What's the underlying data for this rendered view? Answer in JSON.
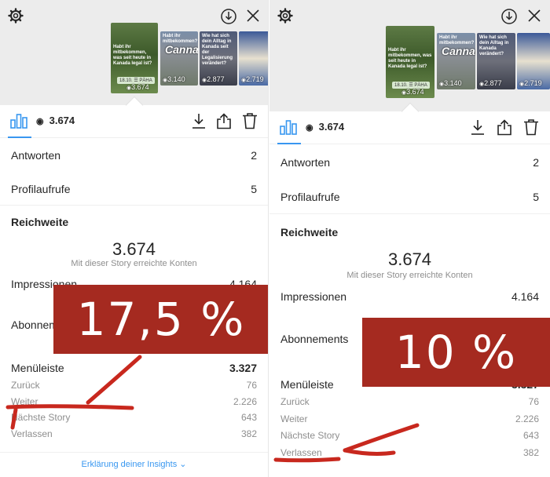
{
  "left": {
    "thumbnails": [
      {
        "caption": "Habt ihr mitbekommen, was seit heute in Kanada legal ist?",
        "pill": "18.10. ☰ PÄHA",
        "views": "3.674",
        "style": "thumb-green"
      },
      {
        "caption": "Habt ihr mitbekommen?",
        "word": "Cannabis",
        "views": "3.140",
        "style": "thumb-city"
      },
      {
        "caption": "Wie hat sich dein Alltag in Kanada seit der Legalisierung verändert?",
        "views": "2.877",
        "style": "thumb-people"
      },
      {
        "caption": "",
        "views": "2.719",
        "style": "thumb-blue"
      }
    ],
    "view_count": "3.674",
    "replies_label": "Antworten",
    "replies_value": "2",
    "profile_visits_label": "Profilaufrufe",
    "profile_visits_value": "5",
    "reach_title": "Reichweite",
    "reach_value": "3.674",
    "reach_caption": "Mit dieser Story erreichte Konten",
    "impressions_label": "Impressionen",
    "impressions_value": "4.164",
    "follows_label": "Abonnements",
    "nav_label": "Menüleiste",
    "nav_value": "3.327",
    "back_label": "Zurück",
    "back_value": "76",
    "forward_label": "Weiter",
    "forward_value": "2.226",
    "next_label": "Nächste Story",
    "next_value": "643",
    "exit_label": "Verlassen",
    "exit_value": "382",
    "footer_link": "Erklärung deiner Insights",
    "overlay_text": "17,5 %"
  },
  "right": {
    "thumbnails": [
      {
        "caption": "Habt ihr mitbekommen, was seit heute in Kanada legal ist?",
        "pill": "18.10. ☰ PÄHA",
        "views": "3.674",
        "style": "thumb-green"
      },
      {
        "caption": "Habt ihr mitbekommen?",
        "word": "Cannabis",
        "views": "3.140",
        "style": "thumb-city"
      },
      {
        "caption": "Wie hat sich dein Alltag in Kanada verändert?",
        "views": "2.877",
        "style": "thumb-people"
      },
      {
        "caption": "",
        "views": "2.719",
        "style": "thumb-blue"
      }
    ],
    "view_count": "3.674",
    "replies_label": "Antworten",
    "replies_value": "2",
    "profile_visits_label": "Profilaufrufe",
    "profile_visits_value": "5",
    "reach_title": "Reichweite",
    "reach_value": "3.674",
    "reach_caption": "Mit dieser Story erreichte Konten",
    "impressions_label": "Impressionen",
    "impressions_value": "4.164",
    "follows_label": "Abonnements",
    "nav_label": "Menüleiste",
    "nav_value": "3.327",
    "back_label": "Zurück",
    "back_value": "76",
    "forward_label": "Weiter",
    "forward_value": "2.226",
    "next_label": "Nächste Story",
    "next_value": "643",
    "exit_label": "Verlassen",
    "exit_value": "382",
    "overlay_text": "10 %"
  },
  "colors": {
    "overlay": "#a52a20",
    "accent": "#3897f0",
    "muted": "#8e8e8e",
    "annotation_stroke": "#c8281e"
  },
  "icons": [
    "settings-gear-icon",
    "download-circle-icon",
    "close-icon",
    "bar-chart-icon",
    "eye-icon",
    "download-icon",
    "share-icon",
    "trash-icon",
    "chevron-down-icon",
    "red-arrow-annotation"
  ]
}
